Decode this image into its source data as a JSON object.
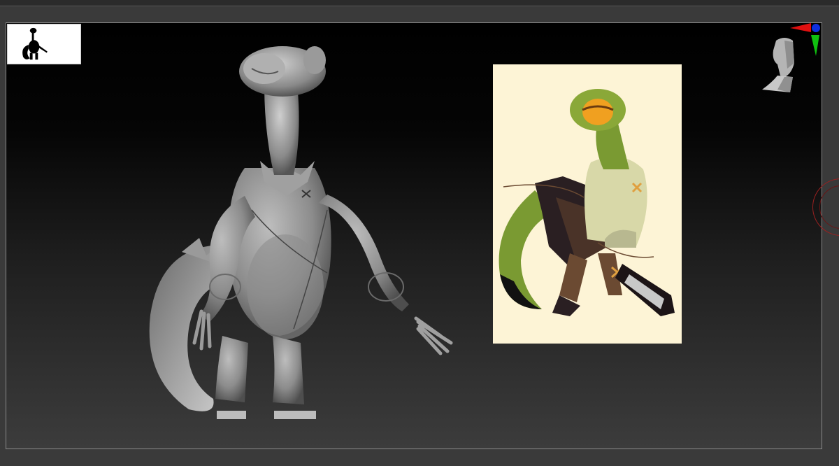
{
  "viewport": {
    "background_top": "#000000",
    "background_bottom": "#3c3c3c",
    "frame_color": "#8a8a8a"
  },
  "thumbnail": {
    "icon": "model-silhouette-icon"
  },
  "model": {
    "icon": "sculpt-model-icon",
    "material_color": "#9a9a9a"
  },
  "reference": {
    "icon": "reference-artwork-icon",
    "background": "#fdf4d6",
    "skin_color": "#7a9a32",
    "shirt_color": "#d8d8a8",
    "dark_color": "#2a1f22",
    "eye_color": "#f0a020"
  },
  "gizmo": {
    "icon": "orientation-head-icon",
    "x_color": "#e01010",
    "y_color": "#10c010",
    "z_color": "#1030e0"
  },
  "navigation": {
    "icon": "rotate-ring-icon",
    "color": "#9a2020"
  }
}
